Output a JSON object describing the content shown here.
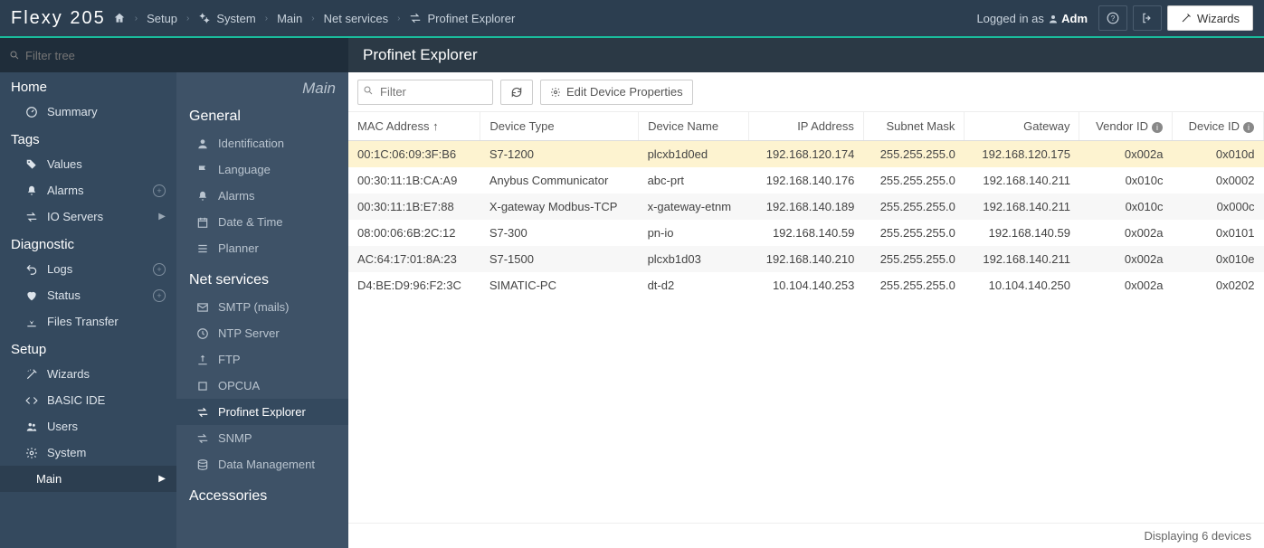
{
  "header": {
    "logo": "Flexy 205",
    "breadcrumb": [
      "Setup",
      "System",
      "Main",
      "Net services",
      "Profinet Explorer"
    ],
    "logged_in_prefix": "Logged in as ",
    "logged_in_user": "Adm",
    "wizards_btn": "Wizards"
  },
  "filter_placeholder": "Filter tree",
  "sidebar1": {
    "groups": [
      {
        "title": "Home",
        "items": [
          {
            "icon": "gauge",
            "label": "Summary"
          }
        ]
      },
      {
        "title": "Tags",
        "items": [
          {
            "icon": "tags",
            "label": "Values"
          },
          {
            "icon": "bell",
            "label": "Alarms",
            "badge": "plus"
          },
          {
            "icon": "exchange",
            "label": "IO Servers",
            "chev": true
          }
        ]
      },
      {
        "title": "Diagnostic",
        "items": [
          {
            "icon": "undo",
            "label": "Logs",
            "badge": "plus"
          },
          {
            "icon": "heart",
            "label": "Status",
            "badge": "plus"
          },
          {
            "icon": "download",
            "label": "Files Transfer"
          }
        ]
      },
      {
        "title": "Setup",
        "items": [
          {
            "icon": "wand",
            "label": "Wizards"
          },
          {
            "icon": "code",
            "label": "BASIC IDE"
          },
          {
            "icon": "users",
            "label": "Users"
          },
          {
            "icon": "gear",
            "label": "System"
          }
        ],
        "sub": "Main"
      }
    ]
  },
  "sidebar2": {
    "context": "Main",
    "groups": [
      {
        "title": "General",
        "items": [
          {
            "icon": "user",
            "label": "Identification"
          },
          {
            "icon": "flag",
            "label": "Language"
          },
          {
            "icon": "bell",
            "label": "Alarms"
          },
          {
            "icon": "calendar",
            "label": "Date & Time"
          },
          {
            "icon": "list",
            "label": "Planner"
          }
        ]
      },
      {
        "title": "Net services",
        "items": [
          {
            "icon": "mail",
            "label": "SMTP (mails)"
          },
          {
            "icon": "clock",
            "label": "NTP Server"
          },
          {
            "icon": "upload",
            "label": "FTP"
          },
          {
            "icon": "square",
            "label": "OPCUA"
          },
          {
            "icon": "exchange",
            "label": "Profinet Explorer",
            "active": true
          },
          {
            "icon": "exchange",
            "label": "SNMP"
          },
          {
            "icon": "db",
            "label": "Data Management"
          }
        ]
      },
      {
        "title": "Accessories",
        "items": []
      }
    ]
  },
  "content": {
    "title": "Profinet Explorer",
    "filter_placeholder": "Filter",
    "edit_btn": "Edit Device Properties",
    "columns": [
      "MAC Address",
      "Device Type",
      "Device Name",
      "IP Address",
      "Subnet Mask",
      "Gateway",
      "Vendor ID",
      "Device ID"
    ],
    "sorted_col": 0,
    "info_cols": [
      6,
      7
    ],
    "rows": [
      {
        "sel": true,
        "cells": [
          "00:1C:06:09:3F:B6",
          "S7-1200",
          "plcxb1d0ed",
          "192.168.120.174",
          "255.255.255.0",
          "192.168.120.175",
          "0x002a",
          "0x010d"
        ]
      },
      {
        "sel": false,
        "cells": [
          "00:30:11:1B:CA:A9",
          "Anybus Communicator",
          "abc-prt",
          "192.168.140.176",
          "255.255.255.0",
          "192.168.140.211",
          "0x010c",
          "0x0002"
        ]
      },
      {
        "sel": false,
        "cells": [
          "00:30:11:1B:E7:88",
          "X-gateway Modbus-TCP",
          "x-gateway-etnm",
          "192.168.140.189",
          "255.255.255.0",
          "192.168.140.211",
          "0x010c",
          "0x000c"
        ]
      },
      {
        "sel": false,
        "cells": [
          "08:00:06:6B:2C:12",
          "S7-300",
          "pn-io",
          "192.168.140.59",
          "255.255.255.0",
          "192.168.140.59",
          "0x002a",
          "0x0101"
        ]
      },
      {
        "sel": false,
        "cells": [
          "AC:64:17:01:8A:23",
          "S7-1500",
          "plcxb1d03",
          "192.168.140.210",
          "255.255.255.0",
          "192.168.140.211",
          "0x002a",
          "0x010e"
        ]
      },
      {
        "sel": false,
        "cells": [
          "D4:BE:D9:96:F2:3C",
          "SIMATIC-PC",
          "dt-d2",
          "10.104.140.253",
          "255.255.255.0",
          "10.104.140.250",
          "0x002a",
          "0x0202"
        ]
      }
    ],
    "status": "Displaying 6 devices"
  }
}
